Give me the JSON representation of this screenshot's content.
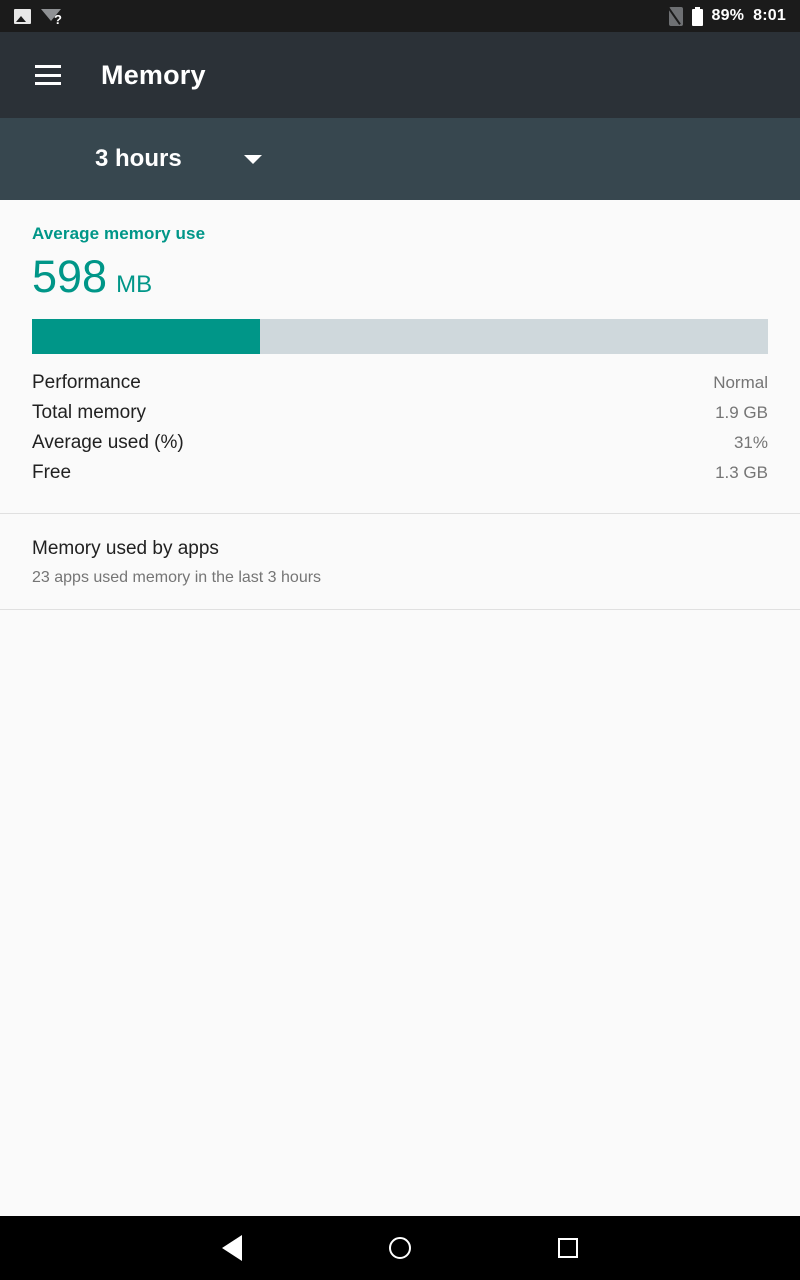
{
  "status_bar": {
    "icons_left": [
      "image-icon",
      "wifi-question-icon"
    ],
    "icons_right": [
      "no-sim-icon",
      "battery-icon"
    ],
    "battery_percent": "89%",
    "clock": "8:01"
  },
  "app_bar": {
    "menu_icon": "hamburger-menu-icon",
    "title": "Memory"
  },
  "time_range_spinner": {
    "selected": "3 hours",
    "caret_icon": "chevron-down-icon"
  },
  "summary": {
    "title": "Average memory use",
    "value": "598",
    "unit": "MB",
    "bar_fill_percent": 31,
    "accent_color": "#009688",
    "track_color": "#cfd8dc"
  },
  "stats": [
    {
      "label": "Performance",
      "value": "Normal"
    },
    {
      "label": "Total memory",
      "value": "1.9 GB"
    },
    {
      "label": "Average used (%)",
      "value": "31%"
    },
    {
      "label": "Free",
      "value": "1.3 GB"
    }
  ],
  "apps_section": {
    "title": "Memory used by apps",
    "subtitle": "23 apps used memory in the last 3 hours"
  },
  "nav_bar": {
    "back": "back-icon",
    "home": "home-icon",
    "recents": "recents-icon"
  }
}
